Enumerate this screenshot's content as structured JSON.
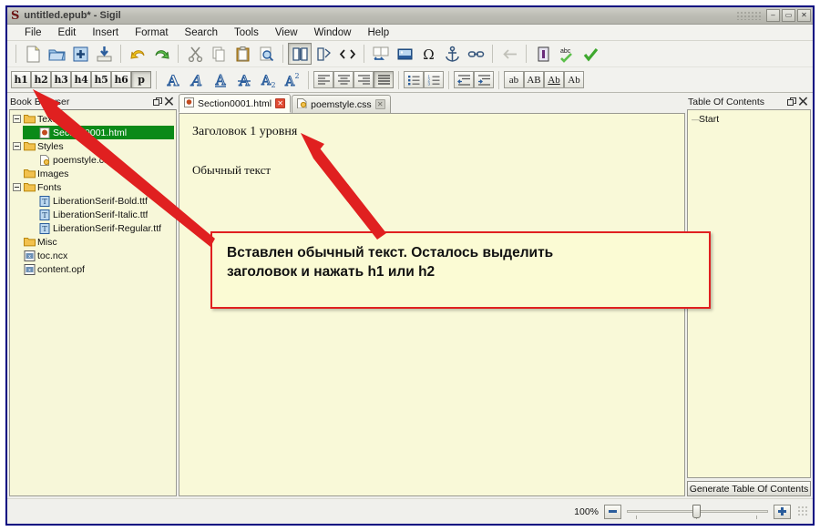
{
  "window": {
    "title": "untitled.epub* - Sigil",
    "logo_glyph": "S",
    "minimize_label": "–",
    "maximize_label": "▭",
    "close_label": "✕"
  },
  "menubar": {
    "items": [
      {
        "label": "File"
      },
      {
        "label": "Edit"
      },
      {
        "label": "Insert"
      },
      {
        "label": "Format"
      },
      {
        "label": "Search"
      },
      {
        "label": "Tools"
      },
      {
        "label": "View"
      },
      {
        "label": "Window"
      },
      {
        "label": "Help"
      }
    ]
  },
  "toolbar_main": {
    "groups": [
      {
        "buttons": [
          {
            "name": "new-file-icon",
            "title": "New"
          },
          {
            "name": "open-file-icon",
            "title": "Open"
          },
          {
            "name": "add-file-icon",
            "title": "Add Existing Files"
          },
          {
            "name": "save-icon",
            "title": "Save"
          }
        ]
      },
      {
        "buttons": [
          {
            "name": "undo-icon",
            "title": "Undo"
          },
          {
            "name": "redo-icon",
            "title": "Redo"
          }
        ]
      },
      {
        "buttons": [
          {
            "name": "cut-icon",
            "title": "Cut"
          },
          {
            "name": "copy-icon",
            "title": "Copy"
          },
          {
            "name": "paste-icon",
            "title": "Paste"
          },
          {
            "name": "find-replace-icon",
            "title": "Find & Replace"
          }
        ]
      },
      {
        "buttons": [
          {
            "name": "book-view-icon",
            "title": "Book View"
          },
          {
            "name": "split-view-icon",
            "title": "Split View"
          },
          {
            "name": "code-view-icon",
            "title": "Code View"
          }
        ]
      },
      {
        "buttons": [
          {
            "name": "split-chapter-icon",
            "title": "Split At Cursor"
          },
          {
            "name": "insert-image-icon",
            "title": "Insert Image"
          },
          {
            "name": "insert-special-char-icon",
            "title": "Insert Special Character"
          },
          {
            "name": "insert-anchor-icon",
            "title": "Insert ID"
          },
          {
            "name": "insert-link-icon",
            "title": "Insert Link"
          }
        ]
      },
      {
        "buttons": [
          {
            "name": "back-arrow-icon",
            "title": "Back"
          }
        ]
      },
      {
        "buttons": [
          {
            "name": "metadata-editor-icon",
            "title": "Metadata Editor"
          },
          {
            "name": "spellcheck-icon",
            "title": "Spellcheck"
          },
          {
            "name": "validate-icon",
            "title": "Validate EPUB"
          }
        ]
      }
    ]
  },
  "toolbar_format": {
    "headings": [
      {
        "label": "h1",
        "pressed": false
      },
      {
        "label": "h2",
        "pressed": false
      },
      {
        "label": "h3",
        "pressed": false
      },
      {
        "label": "h4",
        "pressed": false
      },
      {
        "label": "h5",
        "pressed": false
      },
      {
        "label": "h6",
        "pressed": false
      },
      {
        "label": "p",
        "pressed": true
      }
    ],
    "char_format": [
      {
        "name": "bold-icon",
        "title": "Bold"
      },
      {
        "name": "italic-icon",
        "title": "Italic"
      },
      {
        "name": "underline-icon",
        "title": "Underline"
      },
      {
        "name": "strikethrough-icon",
        "title": "Strikethrough"
      },
      {
        "name": "subscript-icon",
        "title": "Subscript"
      },
      {
        "name": "superscript-icon",
        "title": "Superscript"
      }
    ],
    "alignment": [
      {
        "name": "align-left-icon",
        "title": "Align Left",
        "pressed": false
      },
      {
        "name": "align-center-icon",
        "title": "Align Center",
        "pressed": false
      },
      {
        "name": "align-right-icon",
        "title": "Align Right",
        "pressed": false
      },
      {
        "name": "align-justify-icon",
        "title": "Justify",
        "pressed": true
      }
    ],
    "lists": [
      {
        "name": "bullet-list-icon",
        "title": "Bulleted List"
      },
      {
        "name": "numbered-list-icon",
        "title": "Numbered List"
      }
    ],
    "indent": [
      {
        "name": "decrease-indent-icon",
        "title": "Decrease Indent"
      },
      {
        "name": "increase-indent-icon",
        "title": "Increase Indent"
      }
    ],
    "case": [
      {
        "label": "ab",
        "name": "lowercase-button",
        "title": "Lowercase"
      },
      {
        "label": "AB",
        "name": "uppercase-button",
        "title": "Uppercase"
      },
      {
        "label": "Ab",
        "name": "titlecase-button",
        "title": "Titlecase"
      },
      {
        "label": "Ab",
        "name": "capitalize-button",
        "title": "Capitalize"
      }
    ]
  },
  "book_browser": {
    "title": "Book Browser",
    "float_icon": "❐",
    "close_icon": "✕",
    "tree": [
      {
        "label": "Text",
        "type": "folder",
        "depth": 0,
        "expander": true,
        "selected": false
      },
      {
        "label": "Section0001.html",
        "type": "html",
        "depth": 1,
        "expander": false,
        "selected": true
      },
      {
        "label": "Styles",
        "type": "folder",
        "depth": 0,
        "expander": true,
        "selected": false
      },
      {
        "label": "poemstyle.css",
        "type": "css",
        "depth": 1,
        "expander": false,
        "selected": false
      },
      {
        "label": "Images",
        "type": "folder",
        "depth": 0,
        "expander": false,
        "selected": false
      },
      {
        "label": "Fonts",
        "type": "folder",
        "depth": 0,
        "expander": true,
        "selected": false
      },
      {
        "label": "LiberationSerif-Bold.ttf",
        "type": "font",
        "depth": 1,
        "expander": false,
        "selected": false
      },
      {
        "label": "LiberationSerif-Italic.ttf",
        "type": "font",
        "depth": 1,
        "expander": false,
        "selected": false
      },
      {
        "label": "LiberationSerif-Regular.ttf",
        "type": "font",
        "depth": 1,
        "expander": false,
        "selected": false
      },
      {
        "label": "Misc",
        "type": "folder",
        "depth": 0,
        "expander": false,
        "selected": false
      },
      {
        "label": "toc.ncx",
        "type": "xml",
        "depth": 0,
        "expander": false,
        "selected": false
      },
      {
        "label": "content.opf",
        "type": "xml",
        "depth": 0,
        "expander": false,
        "selected": false
      }
    ]
  },
  "editor": {
    "tabs": [
      {
        "label": "Section0001.html",
        "icon": "html-file-icon",
        "active": true,
        "close_label": "✕"
      },
      {
        "label": "poemstyle.css",
        "icon": "css-file-icon",
        "active": false,
        "close_label": "✕"
      }
    ],
    "document": {
      "heading": "Заголовок 1 уровня",
      "paragraph": "Обычный текст"
    }
  },
  "toc_panel": {
    "title": "Table Of Contents",
    "float_icon": "❐",
    "close_icon": "✕",
    "entries": [
      {
        "label": "Start"
      }
    ],
    "generate_button": "Generate Table Of Contents"
  },
  "statusbar": {
    "zoom_label": "100%",
    "zoom_out_label": "–",
    "zoom_in_label": "+"
  },
  "annotation": {
    "callout_line1": "Вставлен обычный текст. Осталось выделить",
    "callout_line2": "заголовок и нажать h1 или h2",
    "arrow_color": "#e02020"
  },
  "colors": {
    "window_border": "#000080",
    "editor_background": "#f9f9d8",
    "tree_selection": "#0b8a18",
    "callout_background": "#fbfbd4",
    "callout_border": "#e02020",
    "chrome": "#f0f0ec"
  }
}
